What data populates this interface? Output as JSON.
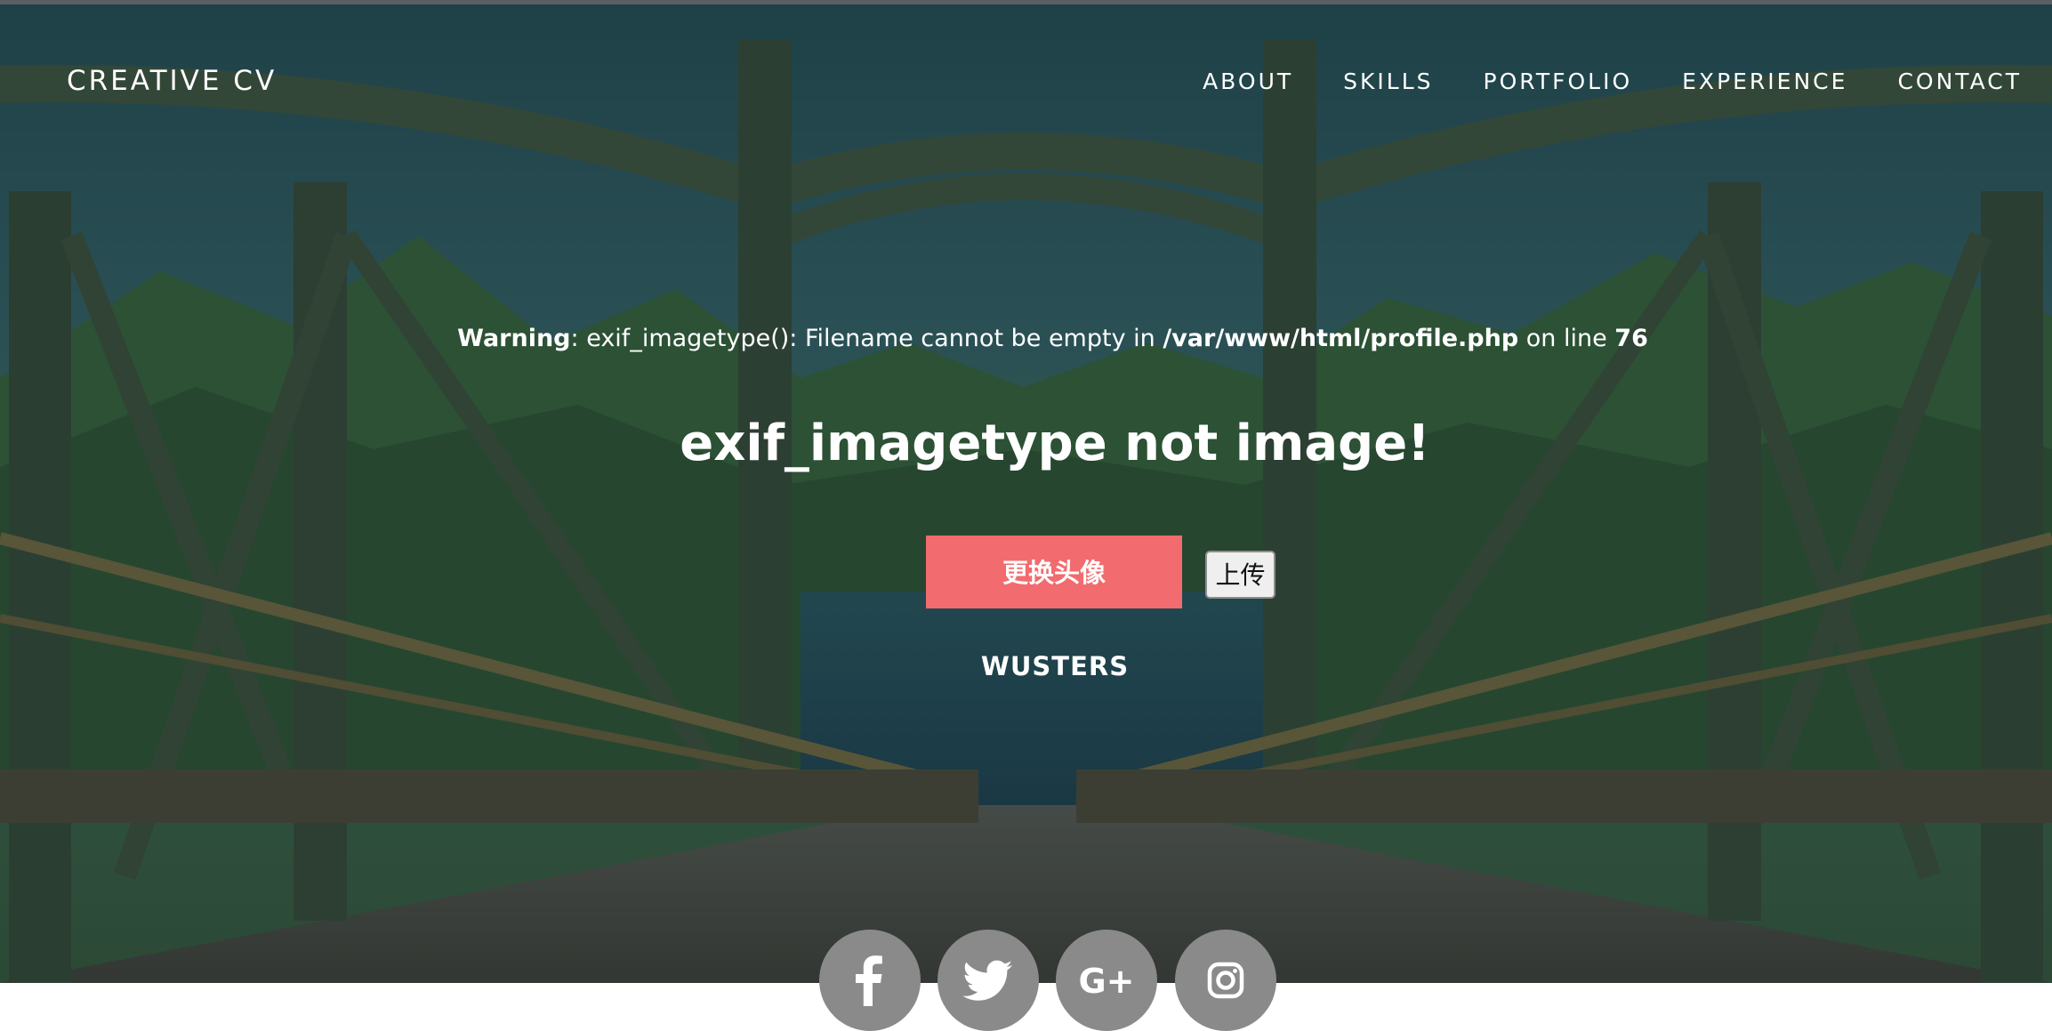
{
  "header": {
    "brand": "CREATIVE CV",
    "nav": [
      "ABOUT",
      "SKILLS",
      "PORTFOLIO",
      "EXPERIENCE",
      "CONTACT"
    ]
  },
  "warning": {
    "label": "Warning",
    "message": ": exif_imagetype(): Filename cannot be empty in ",
    "file": "/var/www/html/profile.php",
    "on_line": " on line ",
    "line_number": "76"
  },
  "headline": "exif_imagetype not image!",
  "buttons": {
    "change_avatar": "更换头像",
    "upload": "上传"
  },
  "username": "WUSTERS",
  "socials": [
    "facebook-icon",
    "twitter-icon",
    "google-plus-icon",
    "instagram-icon"
  ],
  "colors": {
    "accent": "#f26b6e",
    "social_bg": "#8a8a8a",
    "overlay": "#203c3f"
  }
}
